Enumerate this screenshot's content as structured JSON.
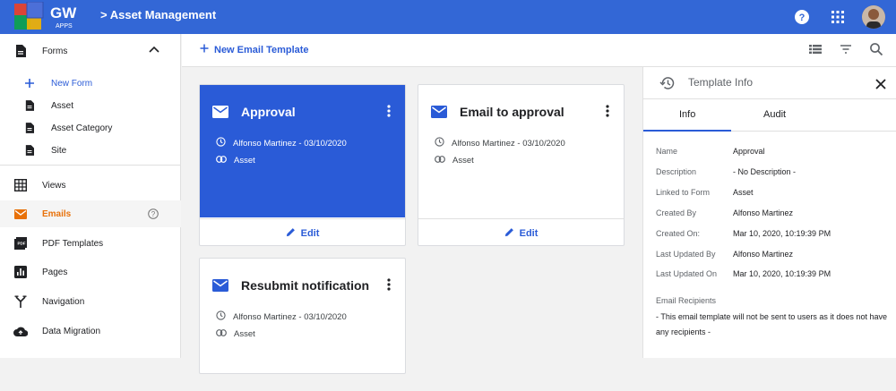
{
  "header": {
    "logo": "GW APPS",
    "breadcrumb": "> Asset Management"
  },
  "sidebar": {
    "forms_label": "Forms",
    "new_form_label": "New Form",
    "forms": [
      "Asset",
      "Asset Category",
      "Site"
    ],
    "items": [
      {
        "label": "Views",
        "icon": "table-icon"
      },
      {
        "label": "Emails",
        "icon": "mail-icon"
      },
      {
        "label": "PDF Templates",
        "icon": "pdf-icon"
      },
      {
        "label": "Pages",
        "icon": "chart-icon"
      },
      {
        "label": "Navigation",
        "icon": "navigation-icon"
      },
      {
        "label": "Data Migration",
        "icon": "cloud-upload-icon"
      }
    ]
  },
  "toolbar": {
    "new_template_label": "New Email Template"
  },
  "cards": [
    {
      "title": "Approval",
      "author": "Alfonso Martinez - 03/10/2020",
      "form": "Asset",
      "edit": "Edit"
    },
    {
      "title": "Email to approval",
      "author": "Alfonso Martinez - 03/10/2020",
      "form": "Asset",
      "edit": "Edit"
    },
    {
      "title": "Resubmit notification",
      "author": "Alfonso Martinez - 03/10/2020",
      "form": "Asset"
    }
  ],
  "panel": {
    "title": "Template Info",
    "tabs": [
      "Info",
      "Audit"
    ],
    "rows": [
      {
        "key": "Name",
        "value": "Approval"
      },
      {
        "key": "Description",
        "value": "- No Description -"
      },
      {
        "key": "Linked to Form",
        "value": "Asset"
      },
      {
        "key": "Created By",
        "value": "Alfonso Martinez"
      },
      {
        "key": "Created On:",
        "value": "Mar 10, 2020, 10:19:39 PM"
      },
      {
        "key": "Last Updated By",
        "value": "Alfonso Martinez"
      },
      {
        "key": "Last Updated On",
        "value": "Mar 10, 2020, 10:19:39 PM"
      }
    ],
    "recipients_label": "Email Recipients",
    "recipients_text": "- This email template will not be sent to users as it does not have any recipients -"
  },
  "colors": {
    "brand": "#3367d6",
    "accent": "#2a5bd7",
    "emails_active": "#e8710a"
  }
}
